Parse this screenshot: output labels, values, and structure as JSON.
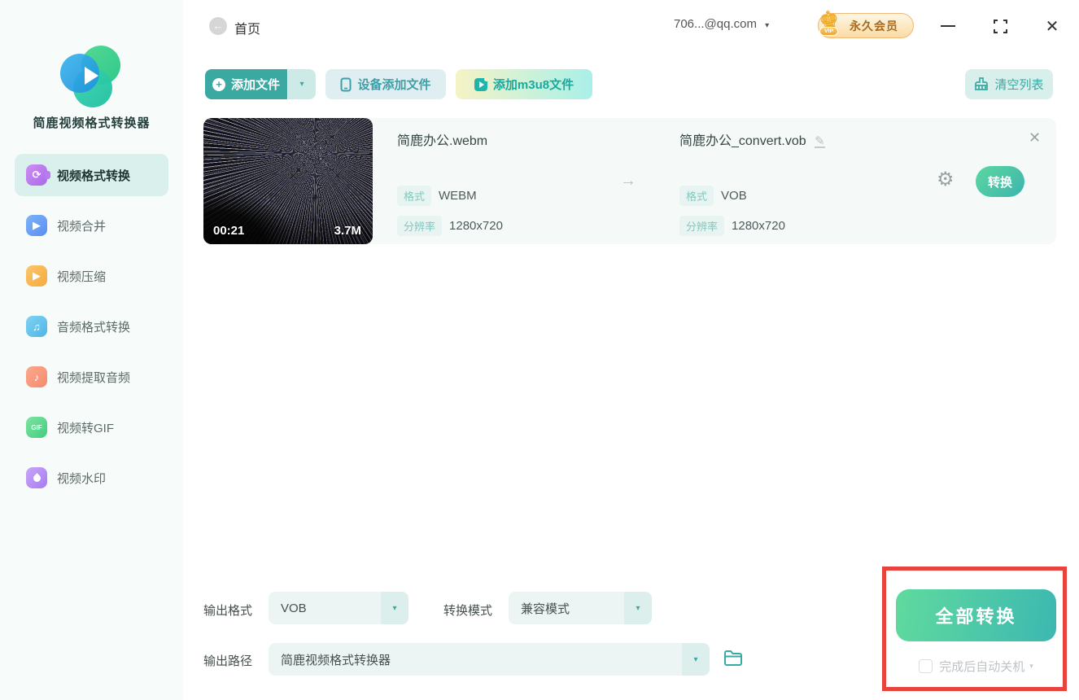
{
  "app": {
    "title": "简鹿视频格式转换器"
  },
  "sidebar": {
    "items": [
      {
        "label": "视频格式转换",
        "icon": "video-format-convert-icon",
        "active": true
      },
      {
        "label": "视频合并",
        "icon": "video-merge-icon",
        "active": false
      },
      {
        "label": "视频压缩",
        "icon": "video-compress-icon",
        "active": false
      },
      {
        "label": "音频格式转换",
        "icon": "audio-format-convert-icon",
        "active": false
      },
      {
        "label": "视频提取音频",
        "icon": "extract-audio-icon",
        "active": false
      },
      {
        "label": "视频转GIF",
        "icon": "video-to-gif-icon",
        "active": false
      },
      {
        "label": "视频水印",
        "icon": "video-watermark-icon",
        "active": false
      }
    ],
    "gif_icon_text": "GIF"
  },
  "header": {
    "home_label": "首页",
    "account": "706...@qq.com",
    "vip_label": "永久会员",
    "vip_small": "VIP"
  },
  "toolbar": {
    "add_file": "添加文件",
    "add_from_device": "设备添加文件",
    "add_m3u8": "添加m3u8文件",
    "clear_list": "清空列表"
  },
  "file_item": {
    "duration": "00:21",
    "size": "3.7M",
    "labels": {
      "format": "格式",
      "resolution": "分辨率"
    },
    "source": {
      "name": "简鹿办公.webm",
      "format": "WEBM",
      "resolution": "1280x720"
    },
    "target": {
      "name": "简鹿办公_convert.vob",
      "format": "VOB",
      "resolution": "1280x720"
    },
    "convert_label": "转换"
  },
  "footer": {
    "output_format_label": "输出格式",
    "output_format_value": "VOB",
    "convert_mode_label": "转换模式",
    "convert_mode_value": "兼容模式",
    "output_path_label": "输出路径",
    "output_path_value": "简鹿视频格式转换器",
    "convert_all_label": "全部转换",
    "auto_shutdown_label": "完成后自动关机",
    "auto_shutdown_checked": false
  },
  "colors": {
    "accent_teal": "#3aa9a2",
    "convert_gradient_start": "#5fd89f",
    "convert_gradient_end": "#3cb8b1",
    "highlight_red": "#e8433c",
    "vip_gold": "#f5b73c"
  }
}
